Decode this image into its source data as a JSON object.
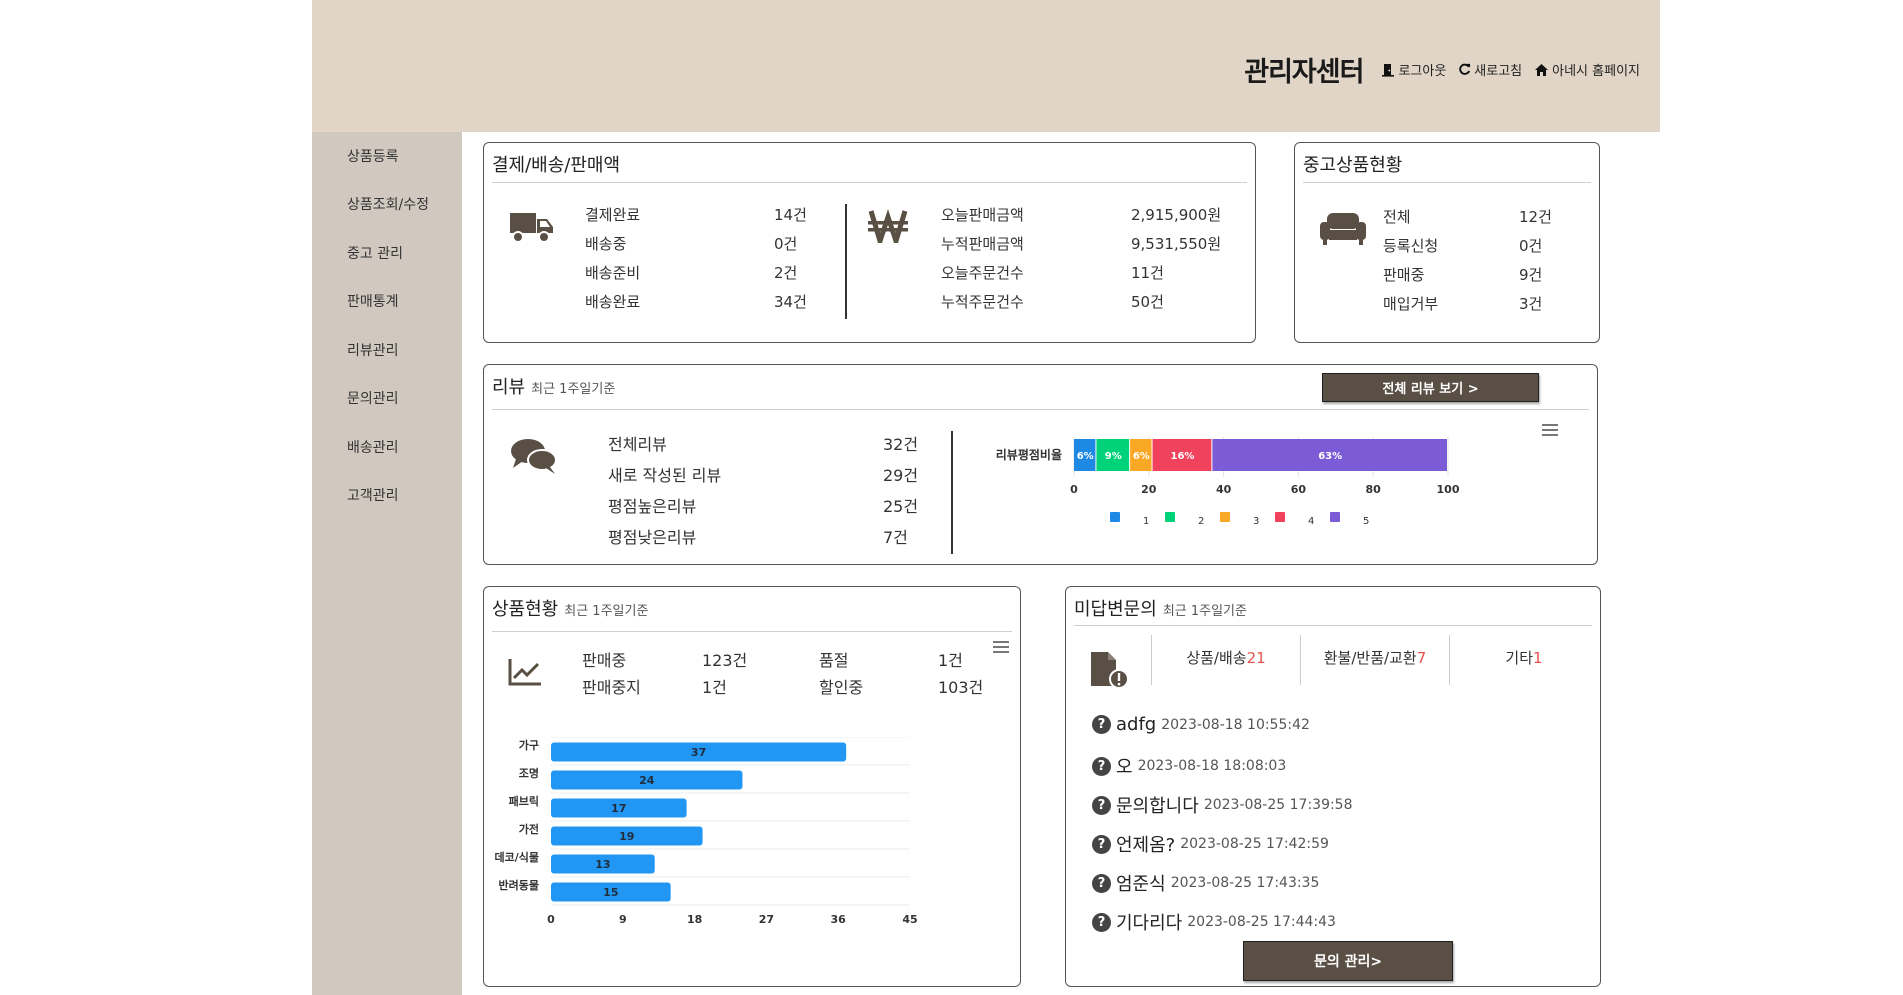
{
  "header": {
    "title": "관리자센터",
    "logout": "로그아웃",
    "refresh": "새로고침",
    "homepage": "아네시 홈페이지",
    "bg_color": "#e0d5c6"
  },
  "sidebar": {
    "items": [
      {
        "label": "상품등록"
      },
      {
        "label": "상품조회/수정"
      },
      {
        "label": "중고 관리"
      },
      {
        "label": "판매통계"
      },
      {
        "label": "리뷰관리"
      },
      {
        "label": "문의관리"
      },
      {
        "label": "배송관리"
      },
      {
        "label": "고객관리"
      }
    ]
  },
  "payment": {
    "title": "결제/배송/판매액",
    "delivery_rows": [
      {
        "label": "결제완료",
        "value": "14건"
      },
      {
        "label": "배송중",
        "value": "0건"
      },
      {
        "label": "배송준비",
        "value": "2건"
      },
      {
        "label": "배송완료",
        "value": "34건"
      }
    ],
    "sales_rows": [
      {
        "label": "오늘판매금액",
        "value": "2,915,900원"
      },
      {
        "label": "누적판매금액",
        "value": "9,531,550원"
      },
      {
        "label": "오늘주문건수",
        "value": "11건"
      },
      {
        "label": "누적주문건수",
        "value": "50건"
      }
    ]
  },
  "used": {
    "title": "중고상품현황",
    "rows": [
      {
        "label": "전체",
        "value": "12건"
      },
      {
        "label": "등록신청",
        "value": "0건"
      },
      {
        "label": "판매중",
        "value": "9건"
      },
      {
        "label": "매입거부",
        "value": "3건"
      }
    ]
  },
  "review": {
    "title": "리뷰",
    "subtitle": "최근 1주일기준",
    "view_all": "전체 리뷰 보기 >",
    "rows": [
      {
        "label": "전체리뷰",
        "value": "32건"
      },
      {
        "label": "새로 작성된 리뷰",
        "value": "29건"
      },
      {
        "label": "평점높은리뷰",
        "value": "25건"
      },
      {
        "label": "평점낮은리뷰",
        "value": "7건"
      }
    ]
  },
  "products": {
    "title": "상품현황",
    "subtitle": "최근 1주일기준",
    "stats": [
      {
        "label": "판매중",
        "value": "123건"
      },
      {
        "label": "품절",
        "value": "1건"
      },
      {
        "label": "판매중지",
        "value": "1건"
      },
      {
        "label": "할인중",
        "value": "103건"
      }
    ]
  },
  "inquiry": {
    "title": "미답변문의",
    "subtitle": "최근 1주일기준",
    "tabs": [
      {
        "label": "상품/배송",
        "count": "21"
      },
      {
        "label": "환불/반품/교환",
        "count": "7"
      },
      {
        "label": "기타",
        "count": "1"
      }
    ],
    "items": [
      {
        "title": "adfg",
        "time": "2023-08-18 10:55:42"
      },
      {
        "title": "오",
        "time": "2023-08-18 18:08:03"
      },
      {
        "title": "문의합니다",
        "time": "2023-08-25 17:39:58"
      },
      {
        "title": "언제옴?",
        "time": "2023-08-25 17:42:59"
      },
      {
        "title": "엄준식",
        "time": "2023-08-25 17:43:35"
      },
      {
        "title": "기다리다",
        "time": "2023-08-25 17:44:43"
      }
    ],
    "manage_button": "문의 관리>"
  },
  "chart_data": [
    {
      "type": "bar",
      "orientation": "horizontal",
      "stacked": true,
      "normalized_percent": true,
      "categories": [
        "리뷰평점비율"
      ],
      "series": [
        {
          "name": "1",
          "values": [
            6
          ],
          "label": "6%",
          "color": "#1e88e5"
        },
        {
          "name": "2",
          "values": [
            9
          ],
          "label": "9%",
          "color": "#00d27a"
        },
        {
          "name": "3",
          "values": [
            6
          ],
          "label": "6%",
          "color": "#f9a825"
        },
        {
          "name": "4",
          "values": [
            16
          ],
          "label": "16%",
          "color": "#f0425d"
        },
        {
          "name": "5",
          "values": [
            63
          ],
          "label": "63%",
          "color": "#7b5bd6"
        }
      ],
      "xlim": [
        0,
        100
      ],
      "xticks": [
        "0",
        "20",
        "40",
        "60",
        "80",
        "100"
      ],
      "legend": "bottom"
    },
    {
      "type": "bar",
      "orientation": "horizontal",
      "categories": [
        "가구",
        "조명",
        "패브릭",
        "가전",
        "데코/식물",
        "반려동물"
      ],
      "values": [
        37,
        24,
        17,
        19,
        13,
        15
      ],
      "xlim": [
        0,
        45
      ],
      "xticks": [
        "0",
        "9",
        "18",
        "27",
        "36",
        "45"
      ],
      "bar_color": "#2196f3",
      "grid": true
    }
  ]
}
